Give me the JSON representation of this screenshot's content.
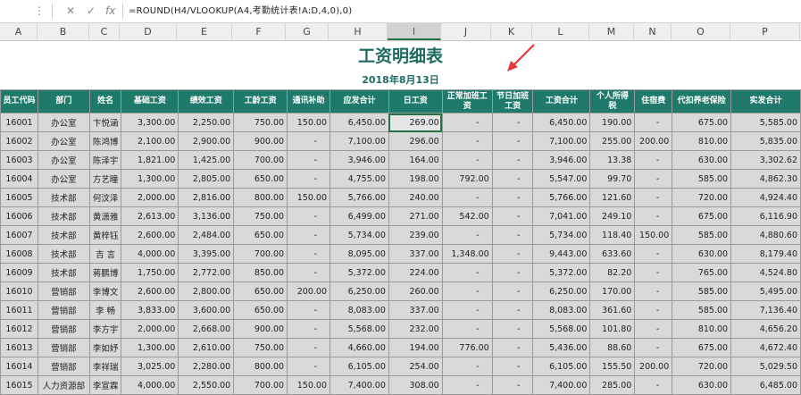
{
  "formula_bar": {
    "cancel_icon": "✕",
    "enter_icon": "✓",
    "fx_label": "fx",
    "formula": "=ROUND(H4/VLOOKUP(A4,考勤统计表!A:D,4,0),0)"
  },
  "columns": [
    "A",
    "B",
    "C",
    "D",
    "E",
    "F",
    "G",
    "H",
    "I",
    "J",
    "K",
    "L",
    "M",
    "N",
    "O",
    "P"
  ],
  "selected_column": "I",
  "sheet": {
    "title": "工资明细表",
    "date": "2018年8月13日"
  },
  "table": {
    "headers": [
      "员工代码",
      "部门",
      "姓名",
      "基础工资",
      "绩效工资",
      "工龄工资",
      "通讯补助",
      "应发合计",
      "日工资",
      "正常加班工资",
      "节日加班工资",
      "工资合计",
      "个人所得税",
      "住宿费",
      "代扣养老保险",
      "实发合计"
    ],
    "rows": [
      [
        "16001",
        "办公室",
        "卞悦涵",
        "3,300.00",
        "2,250.00",
        "750.00",
        "150.00",
        "6,450.00",
        "269.00",
        "-",
        "-",
        "6,450.00",
        "190.00",
        "-",
        "675.00",
        "5,585.00"
      ],
      [
        "16002",
        "办公室",
        "陈鸿博",
        "2,100.00",
        "2,900.00",
        "900.00",
        "-",
        "7,100.00",
        "296.00",
        "-",
        "-",
        "7,100.00",
        "255.00",
        "200.00",
        "810.00",
        "5,835.00"
      ],
      [
        "16003",
        "办公室",
        "陈泽宇",
        "1,821.00",
        "1,425.00",
        "700.00",
        "-",
        "3,946.00",
        "164.00",
        "-",
        "-",
        "3,946.00",
        "13.38",
        "-",
        "630.00",
        "3,302.62"
      ],
      [
        "16004",
        "办公室",
        "方艺曈",
        "1,300.00",
        "2,805.00",
        "650.00",
        "-",
        "4,755.00",
        "198.00",
        "792.00",
        "-",
        "5,547.00",
        "99.70",
        "-",
        "585.00",
        "4,862.30"
      ],
      [
        "16005",
        "技术部",
        "何汶泽",
        "2,000.00",
        "2,816.00",
        "800.00",
        "150.00",
        "5,766.00",
        "240.00",
        "-",
        "-",
        "5,766.00",
        "121.60",
        "-",
        "720.00",
        "4,924.40"
      ],
      [
        "16006",
        "技术部",
        "黄潇雅",
        "2,613.00",
        "3,136.00",
        "750.00",
        "-",
        "6,499.00",
        "271.00",
        "542.00",
        "-",
        "7,041.00",
        "249.10",
        "-",
        "675.00",
        "6,116.90"
      ],
      [
        "16007",
        "技术部",
        "黄梓钰",
        "2,600.00",
        "2,484.00",
        "650.00",
        "-",
        "5,734.00",
        "239.00",
        "-",
        "-",
        "5,734.00",
        "118.40",
        "150.00",
        "585.00",
        "4,880.60"
      ],
      [
        "16008",
        "技术部",
        "吉 言",
        "4,000.00",
        "3,395.00",
        "700.00",
        "-",
        "8,095.00",
        "337.00",
        "1,348.00",
        "-",
        "9,443.00",
        "633.60",
        "-",
        "630.00",
        "8,179.40"
      ],
      [
        "16009",
        "技术部",
        "蒋鹏博",
        "1,750.00",
        "2,772.00",
        "850.00",
        "-",
        "5,372.00",
        "224.00",
        "-",
        "-",
        "5,372.00",
        "82.20",
        "-",
        "765.00",
        "4,524.80"
      ],
      [
        "16010",
        "营销部",
        "李博文",
        "2,600.00",
        "2,800.00",
        "650.00",
        "200.00",
        "6,250.00",
        "260.00",
        "-",
        "-",
        "6,250.00",
        "170.00",
        "-",
        "585.00",
        "5,495.00"
      ],
      [
        "16011",
        "营销部",
        "李 畅",
        "3,833.00",
        "3,600.00",
        "650.00",
        "-",
        "8,083.00",
        "337.00",
        "-",
        "-",
        "8,083.00",
        "361.60",
        "-",
        "585.00",
        "7,136.40"
      ],
      [
        "16012",
        "营销部",
        "李方宇",
        "2,000.00",
        "2,668.00",
        "900.00",
        "-",
        "5,568.00",
        "232.00",
        "-",
        "-",
        "5,568.00",
        "101.80",
        "-",
        "810.00",
        "4,656.20"
      ],
      [
        "16013",
        "营销部",
        "李如妤",
        "1,300.00",
        "2,610.00",
        "750.00",
        "-",
        "4,660.00",
        "194.00",
        "776.00",
        "-",
        "5,436.00",
        "88.60",
        "-",
        "675.00",
        "4,672.40"
      ],
      [
        "16014",
        "营销部",
        "李祥瑞",
        "3,025.00",
        "2,280.00",
        "800.00",
        "-",
        "6,105.00",
        "254.00",
        "-",
        "-",
        "6,105.00",
        "155.50",
        "200.00",
        "720.00",
        "5,029.50"
      ],
      [
        "16015",
        "人力资源部",
        "李宣霖",
        "4,000.00",
        "2,550.00",
        "700.00",
        "150.00",
        "7,400.00",
        "308.00",
        "-",
        "-",
        "7,400.00",
        "285.00",
        "-",
        "630.00",
        "6,485.00"
      ]
    ]
  },
  "colors": {
    "header_bg": "#1f7a6b",
    "title": "#1e6b62",
    "active": "#217346",
    "arrow": "#e53a3a"
  }
}
